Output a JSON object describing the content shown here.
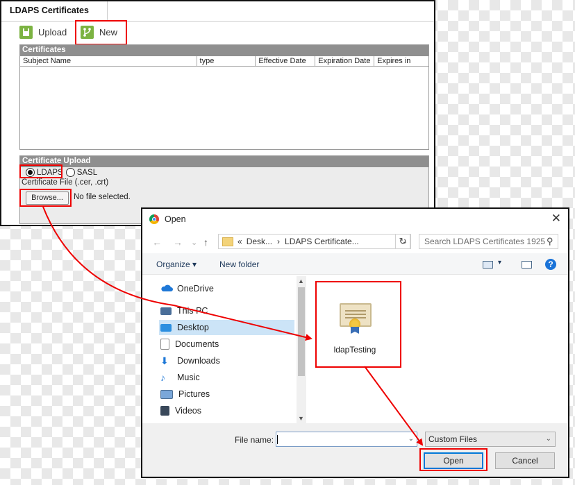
{
  "ldaps": {
    "tab_title": "LDAPS Certificates",
    "toolbar": {
      "upload_label": "Upload",
      "new_label": "New"
    },
    "certificates": {
      "header": "Certificates",
      "columns": [
        "Subject Name",
        "type",
        "Effective Date",
        "Expiration Date",
        "Expires in"
      ]
    },
    "upload": {
      "header": "Certificate Upload",
      "radio_ldaps": "LDAPS",
      "radio_sasl": "SASL",
      "selected_radio": "LDAPS",
      "file_label": "Certificate File (.cer, .crt)",
      "browse_label": "Browse...",
      "no_file": "No file selected."
    },
    "accent_color": "#7cb342"
  },
  "dialog": {
    "title": "Open",
    "address": {
      "prefix": "«",
      "segment1": "Desk...",
      "separator": "›",
      "segment2": "LDAPS Certificate..."
    },
    "search_placeholder": "Search LDAPS Certificates 1925",
    "organize_label": "Organize",
    "new_folder_label": "New folder",
    "help_label": "?",
    "nav": [
      {
        "label": "OneDrive",
        "icon": "onedrive-icon"
      },
      {
        "label": "This PC",
        "icon": "pc-icon"
      },
      {
        "label": "Desktop",
        "icon": "desktop-icon",
        "selected": true
      },
      {
        "label": "Documents",
        "icon": "documents-icon"
      },
      {
        "label": "Downloads",
        "icon": "downloads-icon"
      },
      {
        "label": "Music",
        "icon": "music-icon"
      },
      {
        "label": "Pictures",
        "icon": "pictures-icon"
      },
      {
        "label": "Videos",
        "icon": "videos-icon"
      }
    ],
    "file": {
      "name": "ldapTesting",
      "icon": "certificate-icon"
    },
    "file_name_label": "File name:",
    "file_name_value": "",
    "filter": "Custom Files",
    "open_label": "Open",
    "cancel_label": "Cancel"
  },
  "highlight_color": "#e00000"
}
